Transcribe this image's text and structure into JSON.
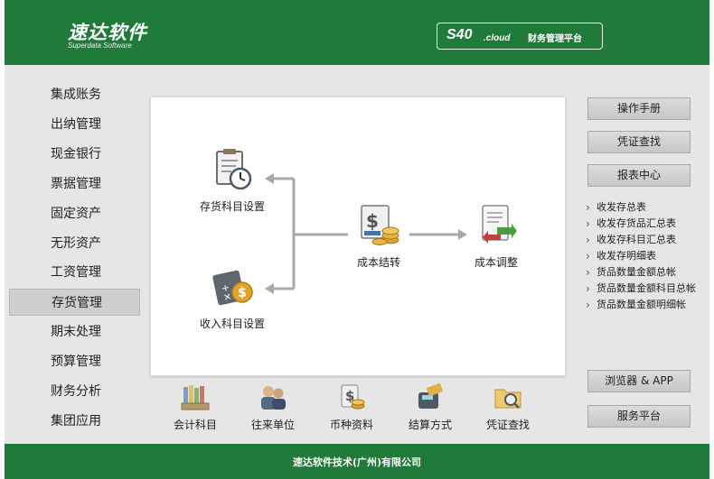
{
  "header": {
    "logo_cn": "速达软件",
    "logo_en": "Superdata Software",
    "cloud_s40": "S40",
    "cloud_suffix": ".cloud",
    "cloud_platform": "财务管理平台"
  },
  "sidebar": {
    "items": [
      {
        "label": "集成账务"
      },
      {
        "label": "出纳管理"
      },
      {
        "label": "现金银行"
      },
      {
        "label": "票据管理"
      },
      {
        "label": "固定资产"
      },
      {
        "label": "无形资产"
      },
      {
        "label": "工资管理"
      },
      {
        "label": "存货管理",
        "active": true
      },
      {
        "label": "期末处理"
      },
      {
        "label": "预算管理"
      },
      {
        "label": "财务分析"
      },
      {
        "label": "集团应用"
      }
    ]
  },
  "flow": {
    "inventory_subject": "存货科目设置",
    "income_subject": "收入科目设置",
    "cost_carry": "成本结转",
    "cost_adjust": "成本调整"
  },
  "bottom": {
    "items": [
      {
        "label": "会计科目"
      },
      {
        "label": "往来单位"
      },
      {
        "label": "币种资料"
      },
      {
        "label": "结算方式"
      },
      {
        "label": "凭证查找"
      }
    ]
  },
  "right": {
    "manual": "操作手册",
    "voucher_search": "凭证查找",
    "report_center": "报表中心",
    "reports": [
      "收发存总表",
      "收发存货品汇总表",
      "收发存科目汇总表",
      "收发存明细表",
      "货品数量金额总帐",
      "货品数量金额科目总帐",
      "货品数量金额明细帐"
    ],
    "browser_app": "浏览器 & APP",
    "service_platform": "服务平台"
  },
  "footer": {
    "company": "速达软件技术(广州)有限公司"
  },
  "colors": {
    "brand_green": "#207a3a",
    "panel_bg": "#e6e6e6"
  }
}
